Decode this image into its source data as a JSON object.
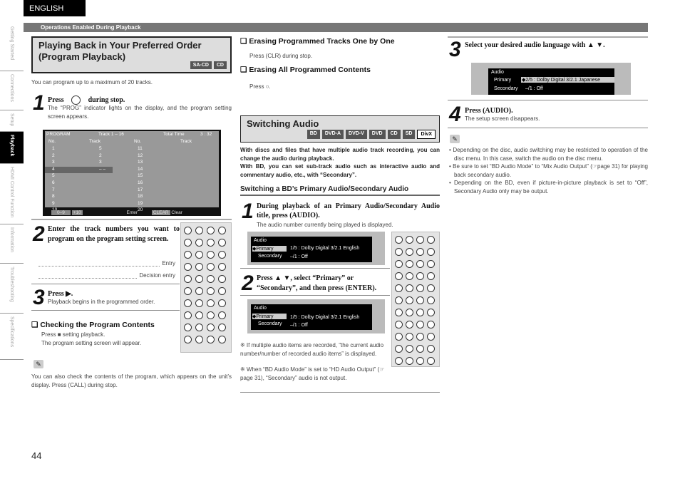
{
  "language_tab": "ENGLISH",
  "header_bar": "Operations Enabled During Playback",
  "side_tabs": [
    "Getting Started",
    "Connections",
    "Setup",
    "Playback",
    "HDMI Control Function",
    "Information",
    "Troubleshooting",
    "Specifications"
  ],
  "active_tab": "Playback",
  "page_number": "44",
  "program": {
    "title": "Playing Back in Your Preferred Order (Program Playback)",
    "badges": [
      "SA-CD",
      "CD"
    ],
    "intro": "You can program up to a maximum of 20 tracks.",
    "step1_a": "Press",
    "step1_b": "during stop.",
    "step1_desc": "The “PROG” indicator lights on the display, and the program setting screen appears.",
    "screen": {
      "title": "PROGRAM",
      "range": "Track 1 – 16",
      "total_label": "Total Time",
      "total": "3 : 32",
      "col_no": "No.",
      "col_track": "Track",
      "left_rows": [
        [
          "1",
          "5"
        ],
        [
          "2",
          "2"
        ],
        [
          "3",
          "3"
        ],
        [
          "4",
          "– –"
        ],
        [
          "5",
          ""
        ],
        [
          "6",
          ""
        ],
        [
          "7",
          ""
        ],
        [
          "8",
          ""
        ],
        [
          "9",
          ""
        ],
        [
          "10",
          ""
        ]
      ],
      "right_rows": [
        "11",
        "12",
        "13",
        "14",
        "15",
        "16",
        "17",
        "18",
        "19",
        "20"
      ],
      "footer_keys": "0–9",
      "footer_plus": "+10",
      "footer_enter": "Enter",
      "footer_clear_key": "CLEAR",
      "footer_clear": "Clear"
    },
    "step2": "Enter the track numbers you want to program on the program setting screen.",
    "entry_label": "Entry",
    "decision_label": "Decision entry",
    "step3": "Press",
    "step3_desc": "Playback begins in the programmed order.",
    "check_title": "Checking the Program Contents",
    "check_a": "Press",
    "check_b": "setting playback.",
    "check_c": "The program setting screen will appear.",
    "note_a": "You can also check the contents of the program, which appears on the unit’s display. Press",
    "note_b": "during stop."
  },
  "erase": {
    "one_title": "Erasing Programmed Tracks One by One",
    "one_a": "Press",
    "one_b": "during stop.",
    "all_title": "Erasing All Programmed Contents",
    "all_a": "Press",
    "all_b": "."
  },
  "audio": {
    "title": "Switching Audio",
    "badges": [
      "BD",
      "DVD-A",
      "DVD-V",
      "DVD",
      "CD",
      "SD"
    ],
    "badge_outline": "DivX",
    "intro1": "With discs and files that have multiple audio track recording, you can change the audio during playback.",
    "intro2": "With BD, you can set sub-track audio such as interactive audio and commentary audio, etc., with “Secondary”.",
    "subhead": "Switching a BD’s Primary Audio/Secondary Audio",
    "step1": "During playback of an Primary Audio/Secondary Audio title, press",
    "step1_desc": "The audio number currently being played is displayed.",
    "screen": {
      "label": "Audio",
      "primary": "◆Primary",
      "primary_val": "1/5 : Dolby Digital  3/2.1   English",
      "secondary": "Secondary",
      "secondary_val": "–/1 : Off"
    },
    "step2_a": "Press",
    "step2_b": ", select “Primary” or “Secondary”, and then press",
    "foot1": "※ If multiple audio items are recorded, “the current audio number/number of recorded audio items” is displayed.",
    "foot2": "※ When “BD Audio Mode” is set to “HD Audio Output” (☞page 31), “Secondary” audio is not output.",
    "step3": "Select your desired audio language with",
    "screen3": {
      "label": "Audio",
      "primary": "Primary",
      "primary_val": "◆2/5 : Dolby Digital  3/2.1   Japanese",
      "secondary": "Secondary",
      "secondary_val": "–/1 : Off"
    },
    "step4": "Press",
    "step4_desc": "The setup screen disappears.",
    "notes": [
      "Depending on the disc, audio switching may be restricted to operation of the disc menu. In this case, switch the audio on the disc menu.",
      "Be sure to set “BD Audio Mode” to “Mix Audio Output” (☞page 31) for playing back secondary audio.",
      "Depending on the BD, even if picture-in-picture playback is set to “Off”, Secondary Audio only may be output."
    ]
  }
}
